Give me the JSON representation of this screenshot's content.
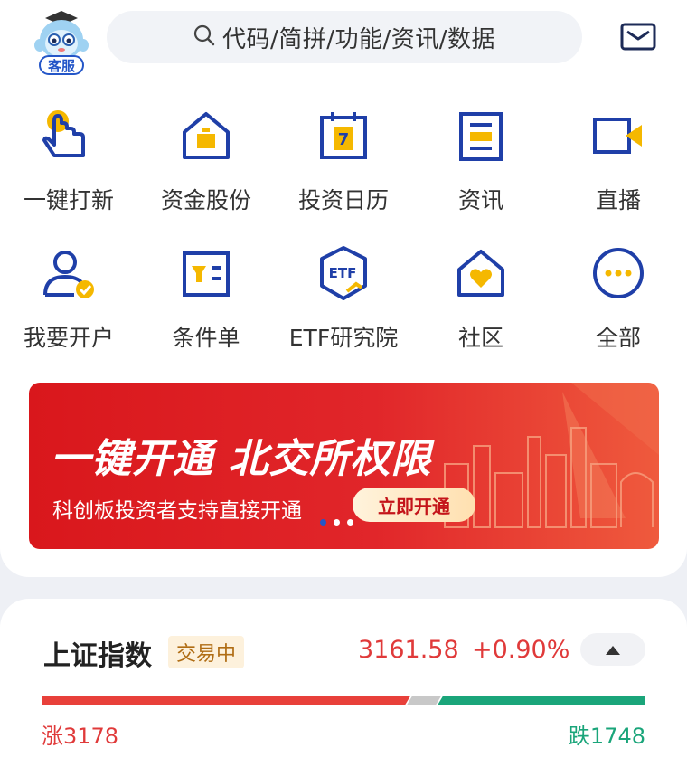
{
  "header": {
    "service_label": "客服",
    "search_placeholder": "代码/简拼/功能/资讯/数据"
  },
  "menu": {
    "row1": [
      {
        "label": "一键打新",
        "icon": "tap-hand-icon"
      },
      {
        "label": "资金股份",
        "icon": "house-wallet-icon"
      },
      {
        "label": "投资日历",
        "icon": "calendar-icon"
      },
      {
        "label": "资讯",
        "icon": "news-icon"
      },
      {
        "label": "直播",
        "icon": "video-camera-icon"
      }
    ],
    "row2": [
      {
        "label": "我要开户",
        "icon": "user-check-icon"
      },
      {
        "label": "条件单",
        "icon": "condition-order-icon"
      },
      {
        "label": "ETF研究院",
        "icon": "etf-badge-icon",
        "icon_text": "ETF"
      },
      {
        "label": "社区",
        "icon": "community-heart-icon"
      },
      {
        "label": "全部",
        "icon": "more-dots-icon"
      }
    ]
  },
  "banner": {
    "title": "一键开通 北交所权限",
    "subtitle": "科创板投资者支持直接开通",
    "cta": "立即开通",
    "active_slide": 0,
    "slide_count": 3
  },
  "index": {
    "name": "上证指数",
    "status": "交易中",
    "price": "3161.58",
    "change_pct": "+0.90%",
    "up_label": "涨3178",
    "down_label": "跌1748",
    "up_color": "#e8403a",
    "down_color": "#1aa57a"
  },
  "colors": {
    "icon_blue": "#1f3fa8",
    "icon_yellow": "#f5b800",
    "banner_red": "#d9171c"
  }
}
